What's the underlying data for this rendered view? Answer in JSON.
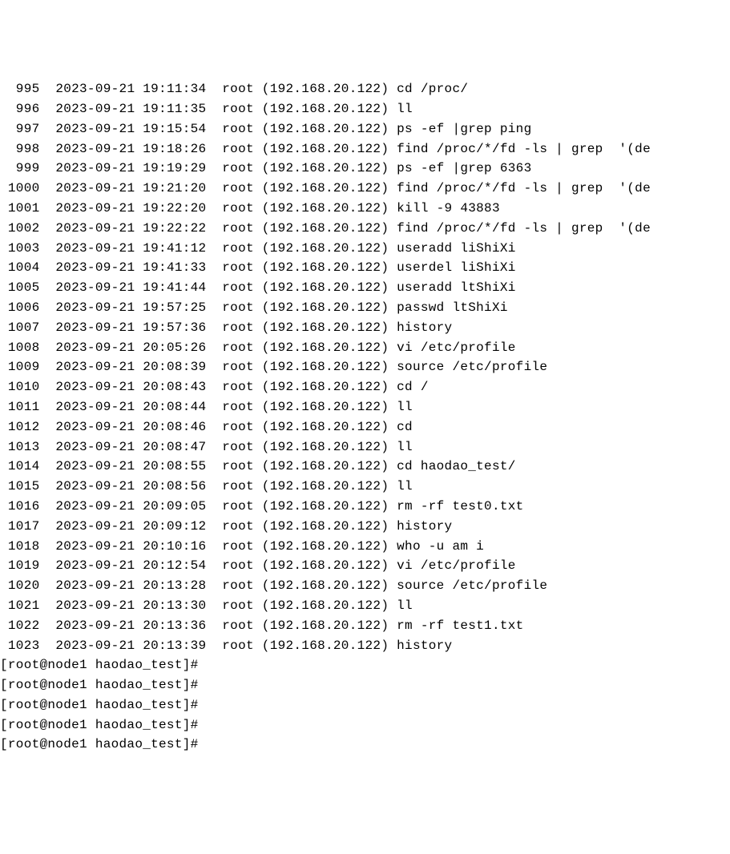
{
  "history": [
    {
      "num": "995",
      "date": "2023-09-21",
      "time": "19:11:34",
      "user": "root",
      "ip": "(192.168.20.122)",
      "cmd": "cd /proc/"
    },
    {
      "num": "996",
      "date": "2023-09-21",
      "time": "19:11:35",
      "user": "root",
      "ip": "(192.168.20.122)",
      "cmd": "ll"
    },
    {
      "num": "997",
      "date": "2023-09-21",
      "time": "19:15:54",
      "user": "root",
      "ip": "(192.168.20.122)",
      "cmd": "ps -ef |grep ping"
    },
    {
      "num": "998",
      "date": "2023-09-21",
      "time": "19:18:26",
      "user": "root",
      "ip": "(192.168.20.122)",
      "cmd": "find /proc/*/fd -ls | grep  '(de"
    },
    {
      "num": "999",
      "date": "2023-09-21",
      "time": "19:19:29",
      "user": "root",
      "ip": "(192.168.20.122)",
      "cmd": "ps -ef |grep 6363"
    },
    {
      "num": "1000",
      "date": "2023-09-21",
      "time": "19:21:20",
      "user": "root",
      "ip": "(192.168.20.122)",
      "cmd": "find /proc/*/fd -ls | grep  '(de"
    },
    {
      "num": "1001",
      "date": "2023-09-21",
      "time": "19:22:20",
      "user": "root",
      "ip": "(192.168.20.122)",
      "cmd": "kill -9 43883"
    },
    {
      "num": "1002",
      "date": "2023-09-21",
      "time": "19:22:22",
      "user": "root",
      "ip": "(192.168.20.122)",
      "cmd": "find /proc/*/fd -ls | grep  '(de"
    },
    {
      "num": "1003",
      "date": "2023-09-21",
      "time": "19:41:12",
      "user": "root",
      "ip": "(192.168.20.122)",
      "cmd": "useradd liShiXi"
    },
    {
      "num": "1004",
      "date": "2023-09-21",
      "time": "19:41:33",
      "user": "root",
      "ip": "(192.168.20.122)",
      "cmd": "userdel liShiXi"
    },
    {
      "num": "1005",
      "date": "2023-09-21",
      "time": "19:41:44",
      "user": "root",
      "ip": "(192.168.20.122)",
      "cmd": "useradd ltShiXi"
    },
    {
      "num": "1006",
      "date": "2023-09-21",
      "time": "19:57:25",
      "user": "root",
      "ip": "(192.168.20.122)",
      "cmd": "passwd ltShiXi"
    },
    {
      "num": "1007",
      "date": "2023-09-21",
      "time": "19:57:36",
      "user": "root",
      "ip": "(192.168.20.122)",
      "cmd": "history"
    },
    {
      "num": "1008",
      "date": "2023-09-21",
      "time": "20:05:26",
      "user": "root",
      "ip": "(192.168.20.122)",
      "cmd": "vi /etc/profile"
    },
    {
      "num": "1009",
      "date": "2023-09-21",
      "time": "20:08:39",
      "user": "root",
      "ip": "(192.168.20.122)",
      "cmd": "source /etc/profile"
    },
    {
      "num": "1010",
      "date": "2023-09-21",
      "time": "20:08:43",
      "user": "root",
      "ip": "(192.168.20.122)",
      "cmd": "cd /"
    },
    {
      "num": "1011",
      "date": "2023-09-21",
      "time": "20:08:44",
      "user": "root",
      "ip": "(192.168.20.122)",
      "cmd": "ll"
    },
    {
      "num": "1012",
      "date": "2023-09-21",
      "time": "20:08:46",
      "user": "root",
      "ip": "(192.168.20.122)",
      "cmd": "cd"
    },
    {
      "num": "1013",
      "date": "2023-09-21",
      "time": "20:08:47",
      "user": "root",
      "ip": "(192.168.20.122)",
      "cmd": "ll"
    },
    {
      "num": "1014",
      "date": "2023-09-21",
      "time": "20:08:55",
      "user": "root",
      "ip": "(192.168.20.122)",
      "cmd": "cd haodao_test/"
    },
    {
      "num": "1015",
      "date": "2023-09-21",
      "time": "20:08:56",
      "user": "root",
      "ip": "(192.168.20.122)",
      "cmd": "ll"
    },
    {
      "num": "1016",
      "date": "2023-09-21",
      "time": "20:09:05",
      "user": "root",
      "ip": "(192.168.20.122)",
      "cmd": "rm -rf test0.txt"
    },
    {
      "num": "1017",
      "date": "2023-09-21",
      "time": "20:09:12",
      "user": "root",
      "ip": "(192.168.20.122)",
      "cmd": "history"
    },
    {
      "num": "1018",
      "date": "2023-09-21",
      "time": "20:10:16",
      "user": "root",
      "ip": "(192.168.20.122)",
      "cmd": "who -u am i"
    },
    {
      "num": "1019",
      "date": "2023-09-21",
      "time": "20:12:54",
      "user": "root",
      "ip": "(192.168.20.122)",
      "cmd": "vi /etc/profile"
    },
    {
      "num": "1020",
      "date": "2023-09-21",
      "time": "20:13:28",
      "user": "root",
      "ip": "(192.168.20.122)",
      "cmd": "source /etc/profile"
    },
    {
      "num": "1021",
      "date": "2023-09-21",
      "time": "20:13:30",
      "user": "root",
      "ip": "(192.168.20.122)",
      "cmd": "ll"
    },
    {
      "num": "1022",
      "date": "2023-09-21",
      "time": "20:13:36",
      "user": "root",
      "ip": "(192.168.20.122)",
      "cmd": "rm -rf test1.txt"
    },
    {
      "num": "1023",
      "date": "2023-09-21",
      "time": "20:13:39",
      "user": "root",
      "ip": "(192.168.20.122)",
      "cmd": "history"
    }
  ],
  "prompts": [
    "[root@node1 haodao_test]#",
    "[root@node1 haodao_test]#",
    "[root@node1 haodao_test]#",
    "[root@node1 haodao_test]#",
    "[root@node1 haodao_test]#"
  ]
}
